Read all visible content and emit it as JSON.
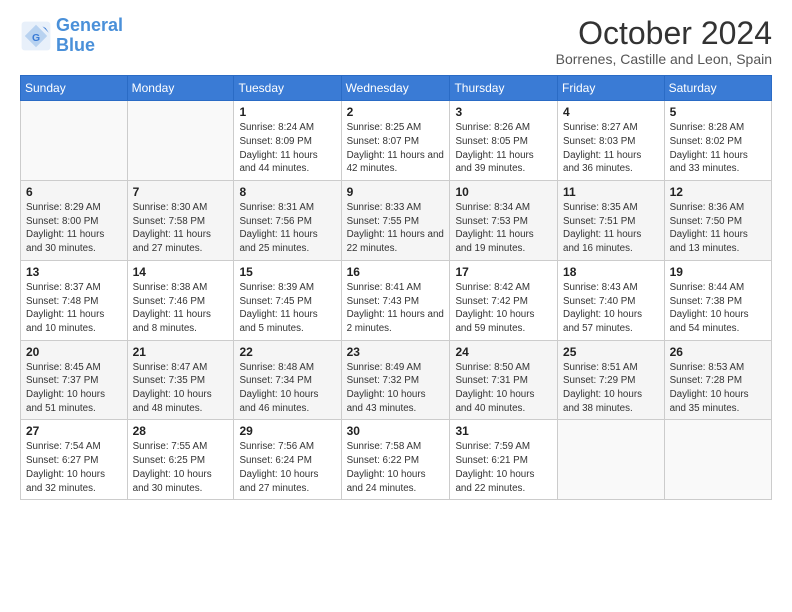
{
  "logo": {
    "line1": "General",
    "line2": "Blue"
  },
  "title": "October 2024",
  "location": "Borrenes, Castille and Leon, Spain",
  "days_of_week": [
    "Sunday",
    "Monday",
    "Tuesday",
    "Wednesday",
    "Thursday",
    "Friday",
    "Saturday"
  ],
  "weeks": [
    [
      {
        "num": "",
        "detail": ""
      },
      {
        "num": "",
        "detail": ""
      },
      {
        "num": "1",
        "detail": "Sunrise: 8:24 AM\nSunset: 8:09 PM\nDaylight: 11 hours and 44 minutes."
      },
      {
        "num": "2",
        "detail": "Sunrise: 8:25 AM\nSunset: 8:07 PM\nDaylight: 11 hours and 42 minutes."
      },
      {
        "num": "3",
        "detail": "Sunrise: 8:26 AM\nSunset: 8:05 PM\nDaylight: 11 hours and 39 minutes."
      },
      {
        "num": "4",
        "detail": "Sunrise: 8:27 AM\nSunset: 8:03 PM\nDaylight: 11 hours and 36 minutes."
      },
      {
        "num": "5",
        "detail": "Sunrise: 8:28 AM\nSunset: 8:02 PM\nDaylight: 11 hours and 33 minutes."
      }
    ],
    [
      {
        "num": "6",
        "detail": "Sunrise: 8:29 AM\nSunset: 8:00 PM\nDaylight: 11 hours and 30 minutes."
      },
      {
        "num": "7",
        "detail": "Sunrise: 8:30 AM\nSunset: 7:58 PM\nDaylight: 11 hours and 27 minutes."
      },
      {
        "num": "8",
        "detail": "Sunrise: 8:31 AM\nSunset: 7:56 PM\nDaylight: 11 hours and 25 minutes."
      },
      {
        "num": "9",
        "detail": "Sunrise: 8:33 AM\nSunset: 7:55 PM\nDaylight: 11 hours and 22 minutes."
      },
      {
        "num": "10",
        "detail": "Sunrise: 8:34 AM\nSunset: 7:53 PM\nDaylight: 11 hours and 19 minutes."
      },
      {
        "num": "11",
        "detail": "Sunrise: 8:35 AM\nSunset: 7:51 PM\nDaylight: 11 hours and 16 minutes."
      },
      {
        "num": "12",
        "detail": "Sunrise: 8:36 AM\nSunset: 7:50 PM\nDaylight: 11 hours and 13 minutes."
      }
    ],
    [
      {
        "num": "13",
        "detail": "Sunrise: 8:37 AM\nSunset: 7:48 PM\nDaylight: 11 hours and 10 minutes."
      },
      {
        "num": "14",
        "detail": "Sunrise: 8:38 AM\nSunset: 7:46 PM\nDaylight: 11 hours and 8 minutes."
      },
      {
        "num": "15",
        "detail": "Sunrise: 8:39 AM\nSunset: 7:45 PM\nDaylight: 11 hours and 5 minutes."
      },
      {
        "num": "16",
        "detail": "Sunrise: 8:41 AM\nSunset: 7:43 PM\nDaylight: 11 hours and 2 minutes."
      },
      {
        "num": "17",
        "detail": "Sunrise: 8:42 AM\nSunset: 7:42 PM\nDaylight: 10 hours and 59 minutes."
      },
      {
        "num": "18",
        "detail": "Sunrise: 8:43 AM\nSunset: 7:40 PM\nDaylight: 10 hours and 57 minutes."
      },
      {
        "num": "19",
        "detail": "Sunrise: 8:44 AM\nSunset: 7:38 PM\nDaylight: 10 hours and 54 minutes."
      }
    ],
    [
      {
        "num": "20",
        "detail": "Sunrise: 8:45 AM\nSunset: 7:37 PM\nDaylight: 10 hours and 51 minutes."
      },
      {
        "num": "21",
        "detail": "Sunrise: 8:47 AM\nSunset: 7:35 PM\nDaylight: 10 hours and 48 minutes."
      },
      {
        "num": "22",
        "detail": "Sunrise: 8:48 AM\nSunset: 7:34 PM\nDaylight: 10 hours and 46 minutes."
      },
      {
        "num": "23",
        "detail": "Sunrise: 8:49 AM\nSunset: 7:32 PM\nDaylight: 10 hours and 43 minutes."
      },
      {
        "num": "24",
        "detail": "Sunrise: 8:50 AM\nSunset: 7:31 PM\nDaylight: 10 hours and 40 minutes."
      },
      {
        "num": "25",
        "detail": "Sunrise: 8:51 AM\nSunset: 7:29 PM\nDaylight: 10 hours and 38 minutes."
      },
      {
        "num": "26",
        "detail": "Sunrise: 8:53 AM\nSunset: 7:28 PM\nDaylight: 10 hours and 35 minutes."
      }
    ],
    [
      {
        "num": "27",
        "detail": "Sunrise: 7:54 AM\nSunset: 6:27 PM\nDaylight: 10 hours and 32 minutes."
      },
      {
        "num": "28",
        "detail": "Sunrise: 7:55 AM\nSunset: 6:25 PM\nDaylight: 10 hours and 30 minutes."
      },
      {
        "num": "29",
        "detail": "Sunrise: 7:56 AM\nSunset: 6:24 PM\nDaylight: 10 hours and 27 minutes."
      },
      {
        "num": "30",
        "detail": "Sunrise: 7:58 AM\nSunset: 6:22 PM\nDaylight: 10 hours and 24 minutes."
      },
      {
        "num": "31",
        "detail": "Sunrise: 7:59 AM\nSunset: 6:21 PM\nDaylight: 10 hours and 22 minutes."
      },
      {
        "num": "",
        "detail": ""
      },
      {
        "num": "",
        "detail": ""
      }
    ]
  ]
}
